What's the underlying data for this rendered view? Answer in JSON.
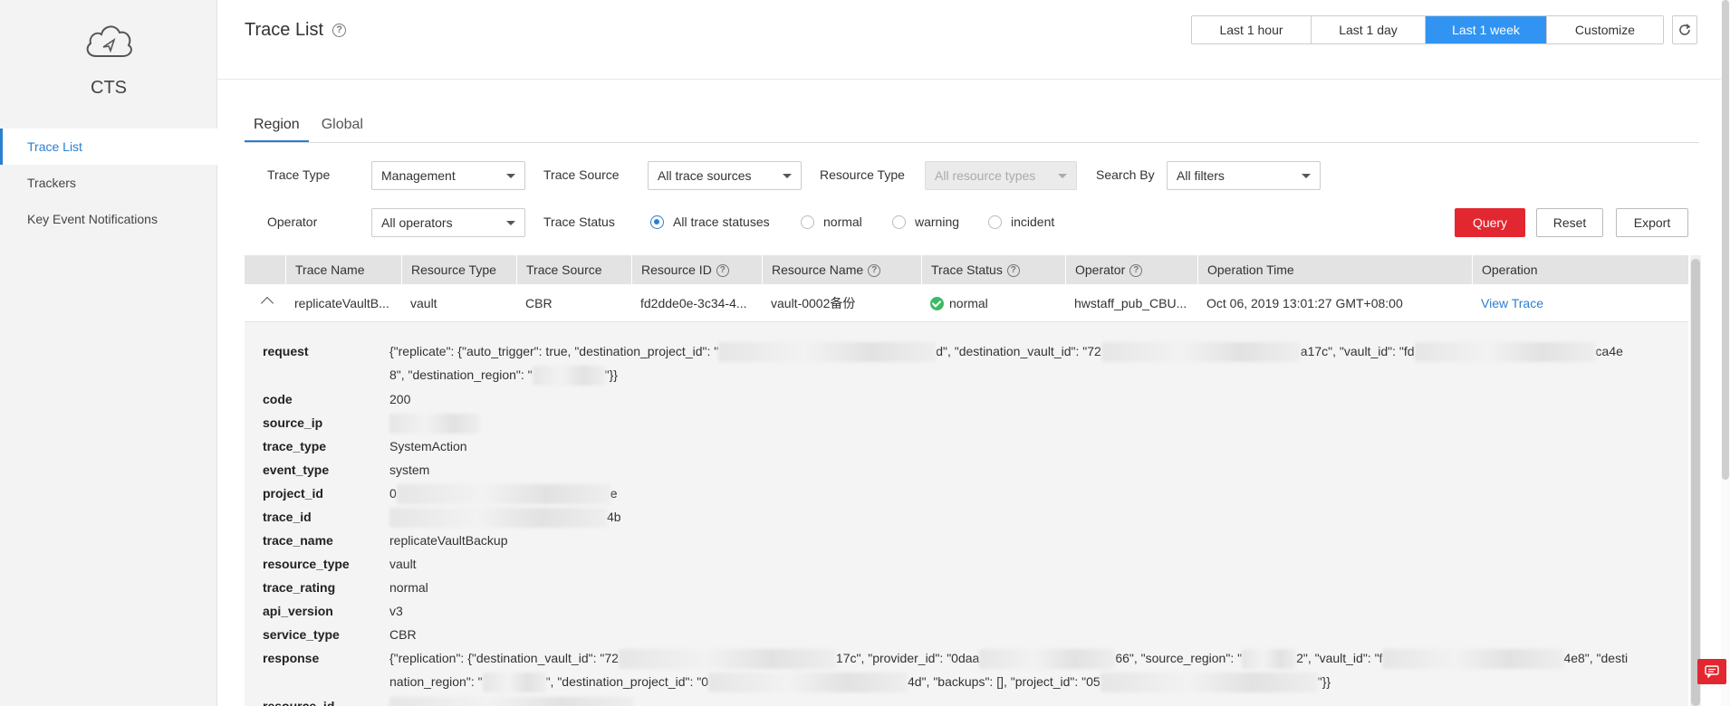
{
  "sidebar": {
    "service_name": "CTS",
    "items": [
      {
        "label": "Trace List",
        "active": true
      },
      {
        "label": "Trackers",
        "active": false
      },
      {
        "label": "Key Event Notifications",
        "active": false
      }
    ]
  },
  "header": {
    "title": "Trace List",
    "time_ranges": [
      {
        "label": "Last 1 hour",
        "active": false
      },
      {
        "label": "Last 1 day",
        "active": false
      },
      {
        "label": "Last 1 week",
        "active": true
      },
      {
        "label": "Customize",
        "active": false
      }
    ]
  },
  "tabs": [
    {
      "label": "Region",
      "active": true
    },
    {
      "label": "Global",
      "active": false
    }
  ],
  "filters": {
    "trace_type_label": "Trace Type",
    "trace_type_value": "Management",
    "trace_source_label": "Trace Source",
    "trace_source_value": "All trace sources",
    "resource_type_label": "Resource Type",
    "resource_type_value": "All resource types",
    "search_by_label": "Search By",
    "search_by_value": "All filters",
    "operator_label": "Operator",
    "operator_value": "All operators",
    "trace_status_label": "Trace Status",
    "statuses": [
      {
        "label": "All trace statuses",
        "checked": true
      },
      {
        "label": "normal",
        "checked": false
      },
      {
        "label": "warning",
        "checked": false
      },
      {
        "label": "incident",
        "checked": false
      }
    ],
    "query_label": "Query",
    "reset_label": "Reset",
    "export_label": "Export"
  },
  "table": {
    "columns": [
      "Trace Name",
      "Resource Type",
      "Trace Source",
      "Resource ID",
      "Resource Name",
      "Trace Status",
      "Operator",
      "Operation Time",
      "Operation"
    ],
    "row": {
      "trace_name": "replicateVaultB...",
      "resource_type": "vault",
      "trace_source": "CBR",
      "resource_id": "fd2dde0e-3c34-4...",
      "resource_name": "vault-0002备份",
      "trace_status": "normal",
      "operator": "hwstaff_pub_CBU...",
      "operation_time": "Oct 06, 2019 13:01:27 GMT+08:00",
      "operation": "View Trace"
    }
  },
  "detail": {
    "request_key": "request",
    "request_p1": "{\"replicate\": {\"auto_trigger\": true, \"destination_project_id\": \"",
    "request_p2": "d\", \"destination_vault_id\": \"72",
    "request_p3": "a17c\", \"vault_id\": \"fd",
    "request_p4": "ca4e",
    "request_p5": "8\", \"destination_region\": \"",
    "request_p6": "\"}}",
    "code_key": "code",
    "code_value": "200",
    "source_ip_key": "source_ip",
    "trace_type_key": "trace_type",
    "trace_type_value": "SystemAction",
    "event_type_key": "event_type",
    "event_type_value": "system",
    "project_id_key": "project_id",
    "project_id_p1": "0",
    "project_id_p2": "e",
    "trace_id_key": "trace_id",
    "trace_id_p2": "4b",
    "trace_name_key": "trace_name",
    "trace_name_value": "replicateVaultBackup",
    "resource_type_key": "resource_type",
    "resource_type_value": "vault",
    "trace_rating_key": "trace_rating",
    "trace_rating_value": "normal",
    "api_version_key": "api_version",
    "api_version_value": "v3",
    "service_type_key": "service_type",
    "service_type_value": "CBR",
    "response_key": "response",
    "response_p1": "{\"replication\": {\"destination_vault_id\": \"72",
    "response_p2": "17c\", \"provider_id\": \"0daa",
    "response_p3": "66\", \"source_region\": \"",
    "response_p4": "2\", \"vault_id\": \"f",
    "response_p5": "4e8\", \"destination_region\": \"",
    "response_p6": "\", \"destination_project_id\": \"0",
    "response_p7": "4d\", \"backups\": [], \"project_id\": \"05",
    "response_p8": "\"}}",
    "resource_id_key": "resource_id"
  },
  "colors": {
    "accent": "#3194f3",
    "link": "#2a7fd3",
    "danger": "#e32730",
    "ok": "#3cba65"
  }
}
